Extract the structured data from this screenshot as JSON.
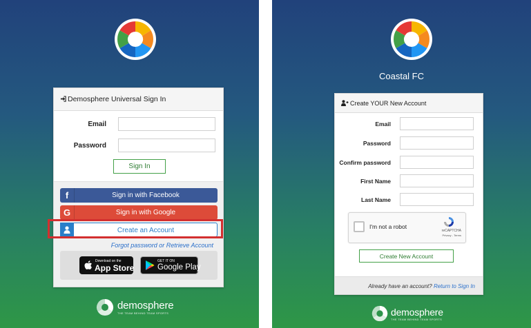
{
  "left": {
    "card_title": "Demosphere Universal Sign In",
    "email_label": "Email",
    "password_label": "Password",
    "sign_in_button": "Sign In",
    "facebook_icon_glyph": "f",
    "facebook_button": "Sign in with Facebook",
    "google_icon_glyph": "G",
    "google_button": "Sign in with Google",
    "create_account_button": "Create an Account",
    "forgot_link": "Forgot password or Retrieve Account",
    "app_store": {
      "small": "Download on the",
      "big": "App Store"
    },
    "google_play": {
      "small": "GET IT ON",
      "big": "Google Play"
    },
    "highlight_color": "#d32f2f"
  },
  "right": {
    "club_name": "Coastal FC",
    "card_title": "Create YOUR New Account",
    "fields": [
      {
        "label": "Email"
      },
      {
        "label": "Password"
      },
      {
        "label": "Confirm password"
      },
      {
        "label": "First Name"
      },
      {
        "label": "Last Name"
      }
    ],
    "recaptcha": {
      "checkbox_label": "I'm not a robot",
      "brand": "reCAPTCHA",
      "links": "Privacy - Terms"
    },
    "create_button": "Create New Account",
    "footer_text": "Already have an account?",
    "footer_link": "Return to Sign In"
  },
  "brand": {
    "name": "demosphere",
    "tagline": "THE TEAM BEHIND TEAM SPORTS"
  },
  "colors": {
    "facebook": "#3b5998",
    "google": "#dd4b39",
    "create_account": "#2a7ec9",
    "accent_green": "#43a047",
    "link_blue": "#2a6fca"
  },
  "icons": {
    "sign_in": "sign-in-icon",
    "add_user": "user-plus-icon",
    "user": "user-icon",
    "apple": "apple-icon",
    "google_play": "google-play-icon"
  }
}
